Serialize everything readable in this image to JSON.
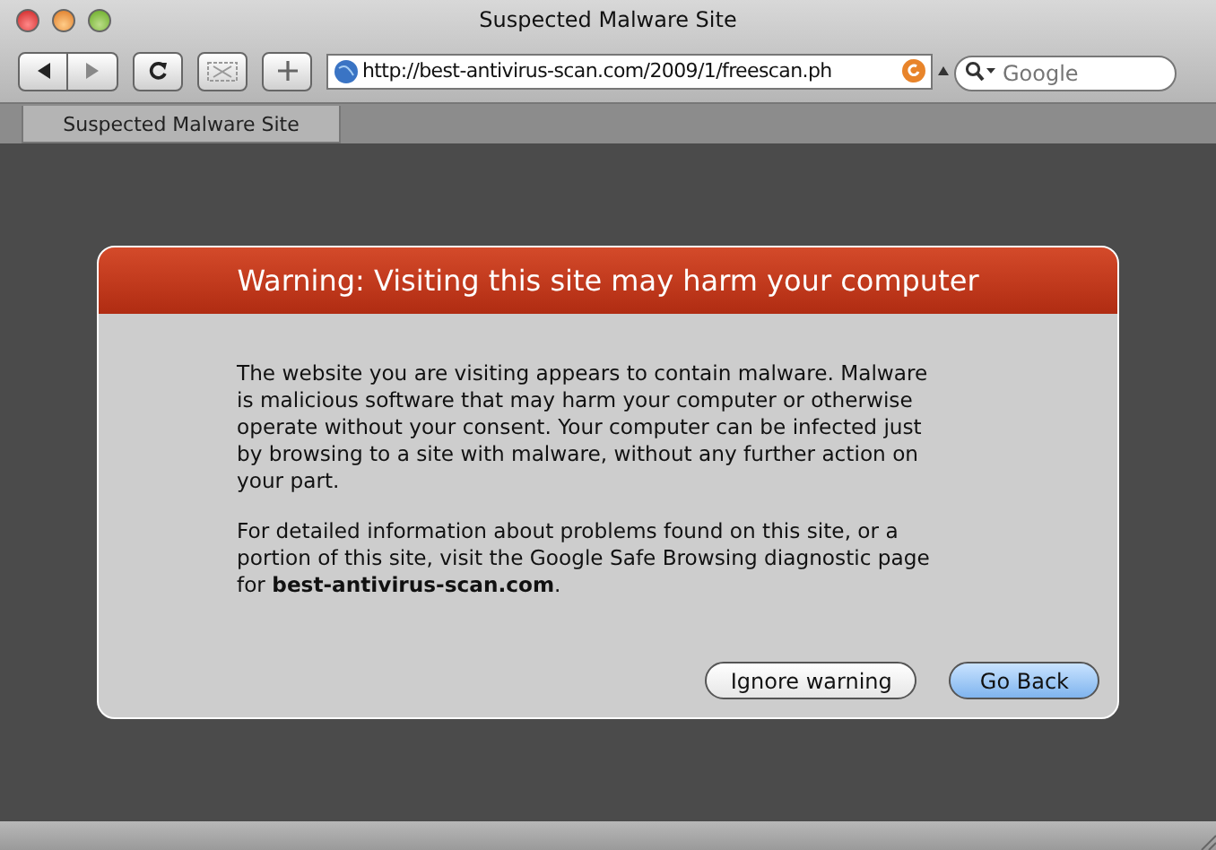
{
  "window": {
    "title": "Suspected Malware Site"
  },
  "toolbar": {
    "url": "http://best-antivirus-scan.com/2009/1/freescan.ph",
    "search": {
      "placeholder": "Google"
    }
  },
  "tabs": [
    {
      "label": "Suspected Malware Site",
      "selected": true
    }
  ],
  "dialog": {
    "title": "Warning: Visiting this site may harm your computer",
    "paragraphs": [
      "The website you are visiting appears to contain malware. Malware is malicious software that may harm your computer or otherwise operate without your consent. Your computer can be infected just by browsing to a site with malware, without any further action on your part.",
      "For detailed information about problems found on this site, or a portion of this site, visit the Google Safe Browsing diagnostic page for **best-antivirus-scan.com**."
    ],
    "buttons": [
      {
        "label": "Ignore warning",
        "default": false
      },
      {
        "label": "Go Back",
        "default": true
      }
    ]
  }
}
